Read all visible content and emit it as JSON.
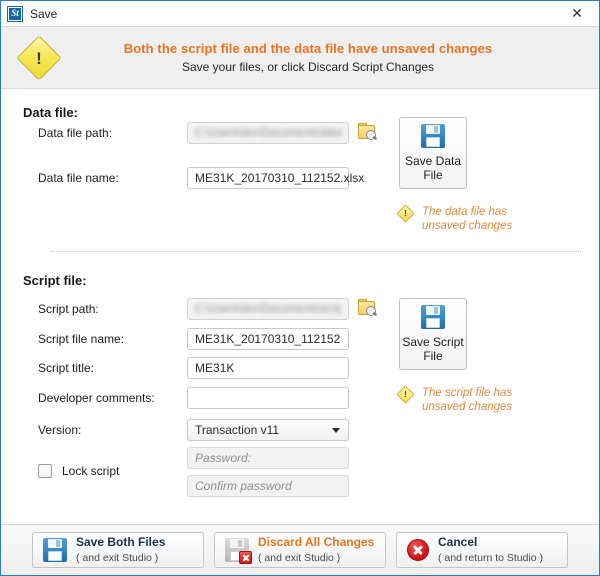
{
  "window": {
    "title": "Save",
    "logo_text": "St",
    "close_label": "✕"
  },
  "banner": {
    "heading": "Both the script file and the data file have unsaved changes",
    "subheading": "Save your files, or click Discard Script Changes",
    "warning_color": "#e8731e"
  },
  "data_section": {
    "title": "Data file:",
    "path_label": "Data file path:",
    "path_value": "C:\\Users\\dev\\Documents\\data",
    "name_label": "Data file name:",
    "name_value": "ME31K_20170310_112152.xlsx",
    "browse_title": "Browse",
    "save_button_line1": "Save Data",
    "save_button_line2": "File",
    "unsaved_note": "The data file has unsaved changes"
  },
  "script_section": {
    "title": "Script file:",
    "path_label": "Script path:",
    "path_value": "C:\\Users\\dev\\Documents\\scripts",
    "filename_label": "Script file name:",
    "filename_value": "ME31K_20170310_112152",
    "title_label": "Script title:",
    "title_value": "ME31K",
    "comments_label": "Developer comments:",
    "comments_value": "",
    "version_label": "Version:",
    "version_value": "Transaction v11",
    "lock_label": "Lock script",
    "lock_checked": false,
    "password_placeholder": "Password:",
    "confirm_placeholder": "Confirm password",
    "save_button_line1": "Save Script",
    "save_button_line2": "File",
    "unsaved_note": "The script file has unsaved changes"
  },
  "footer": {
    "buttons": [
      {
        "main": "Save Both Files",
        "sub": "( and exit Studio )",
        "icon": "floppy-icon",
        "accent": false
      },
      {
        "main": "Discard All Changes",
        "sub": "( and exit Studio )",
        "icon": "floppy-discard-icon",
        "accent": true
      },
      {
        "main": "Cancel",
        "sub": "( and return to Studio )",
        "icon": "cancel-circle-icon",
        "accent": false
      }
    ]
  }
}
